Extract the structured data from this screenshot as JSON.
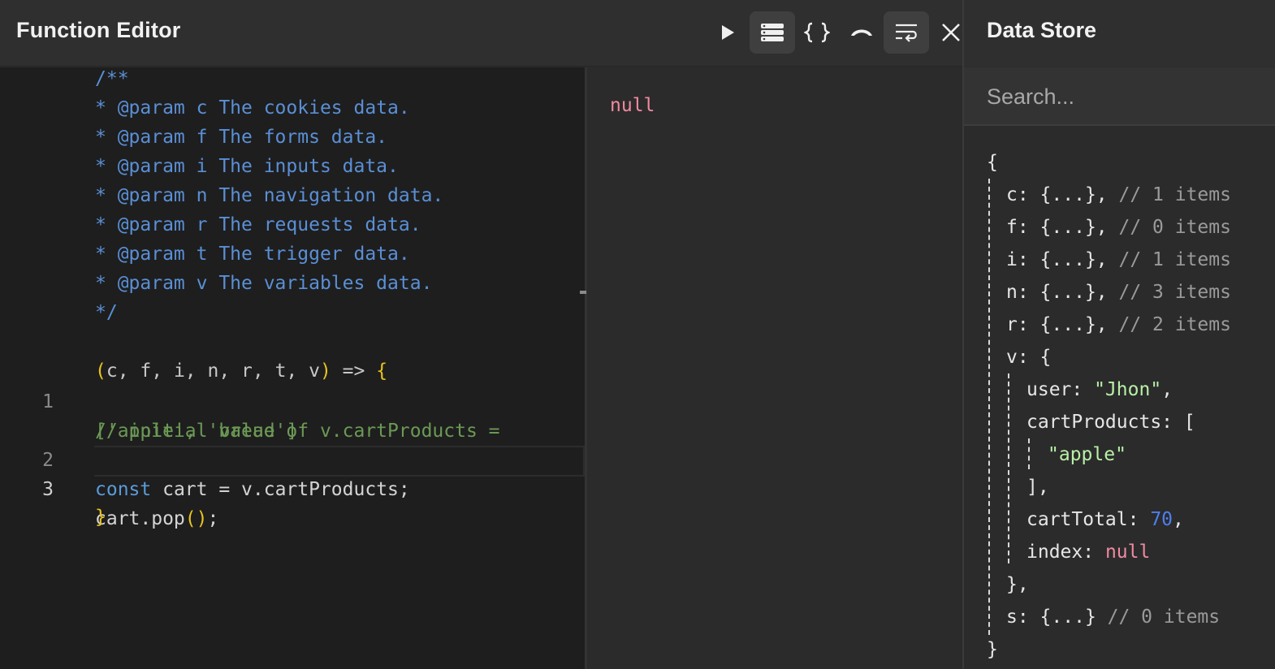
{
  "header": {
    "title": "Function Editor",
    "toolbar": [
      {
        "name": "run",
        "icon": "play-icon",
        "active": false
      },
      {
        "name": "data-view",
        "icon": "list-icon",
        "active": true
      },
      {
        "name": "braces",
        "icon": "braces-icon",
        "active": false
      },
      {
        "name": "collapse",
        "icon": "arch-icon",
        "active": false
      },
      {
        "name": "wrap",
        "icon": "wrap-icon",
        "active": true
      },
      {
        "name": "close",
        "icon": "close-icon",
        "active": false
      }
    ]
  },
  "editor": {
    "doc_lines": [
      "/**",
      "* @param c The cookies data.",
      "* @param f The forms data.",
      "* @param i The inputs data.",
      "* @param n The navigation data.",
      "* @param r The requests data.",
      "* @param t The trigger data.",
      "* @param v The variables data.",
      "*/"
    ],
    "signature": {
      "open": "(",
      "params": "c, f, i, n, r, t, v",
      "close": ")",
      "arrow": " => ",
      "brace": "{"
    },
    "lines": [
      {
        "number": "1",
        "comment_a": "// initial value of v.cartProducts =",
        "comment_b": "['apple', 'bread']"
      },
      {
        "number": "2",
        "keyword": "const",
        "text": " cart = v.cartProducts;"
      },
      {
        "number": "3",
        "text": "cart.pop",
        "open": "(",
        "close": ")",
        "end": ";"
      }
    ],
    "closing": "}"
  },
  "output": {
    "value": "null"
  },
  "store": {
    "title": "Data Store",
    "search_placeholder": "Search...",
    "open_brace": "{",
    "close_brace": "}",
    "entries": [
      {
        "key": "c",
        "value": ": {...}, ",
        "comment": "// 1 items"
      },
      {
        "key": "f",
        "value": ": {...}, ",
        "comment": "// 0 items"
      },
      {
        "key": "i",
        "value": ": {...}, ",
        "comment": "// 1 items"
      },
      {
        "key": "n",
        "value": ": {...}, ",
        "comment": "// 3 items"
      },
      {
        "key": "r",
        "value": ": {...}, ",
        "comment": "// 2 items"
      }
    ],
    "v": {
      "key": "v",
      "open": ": {",
      "user_key": "user",
      "user_value": "\"Jhon\"",
      "cart_key": "cartProducts",
      "cart_open": ": [",
      "cart_item": "\"apple\"",
      "cart_close": "],",
      "total_key": "cartTotal",
      "total_value": "70",
      "index_key": "index",
      "index_value": "null",
      "close": "},"
    },
    "last": {
      "key": "s",
      "value": ": {...} ",
      "comment": "// 0 items"
    }
  }
}
